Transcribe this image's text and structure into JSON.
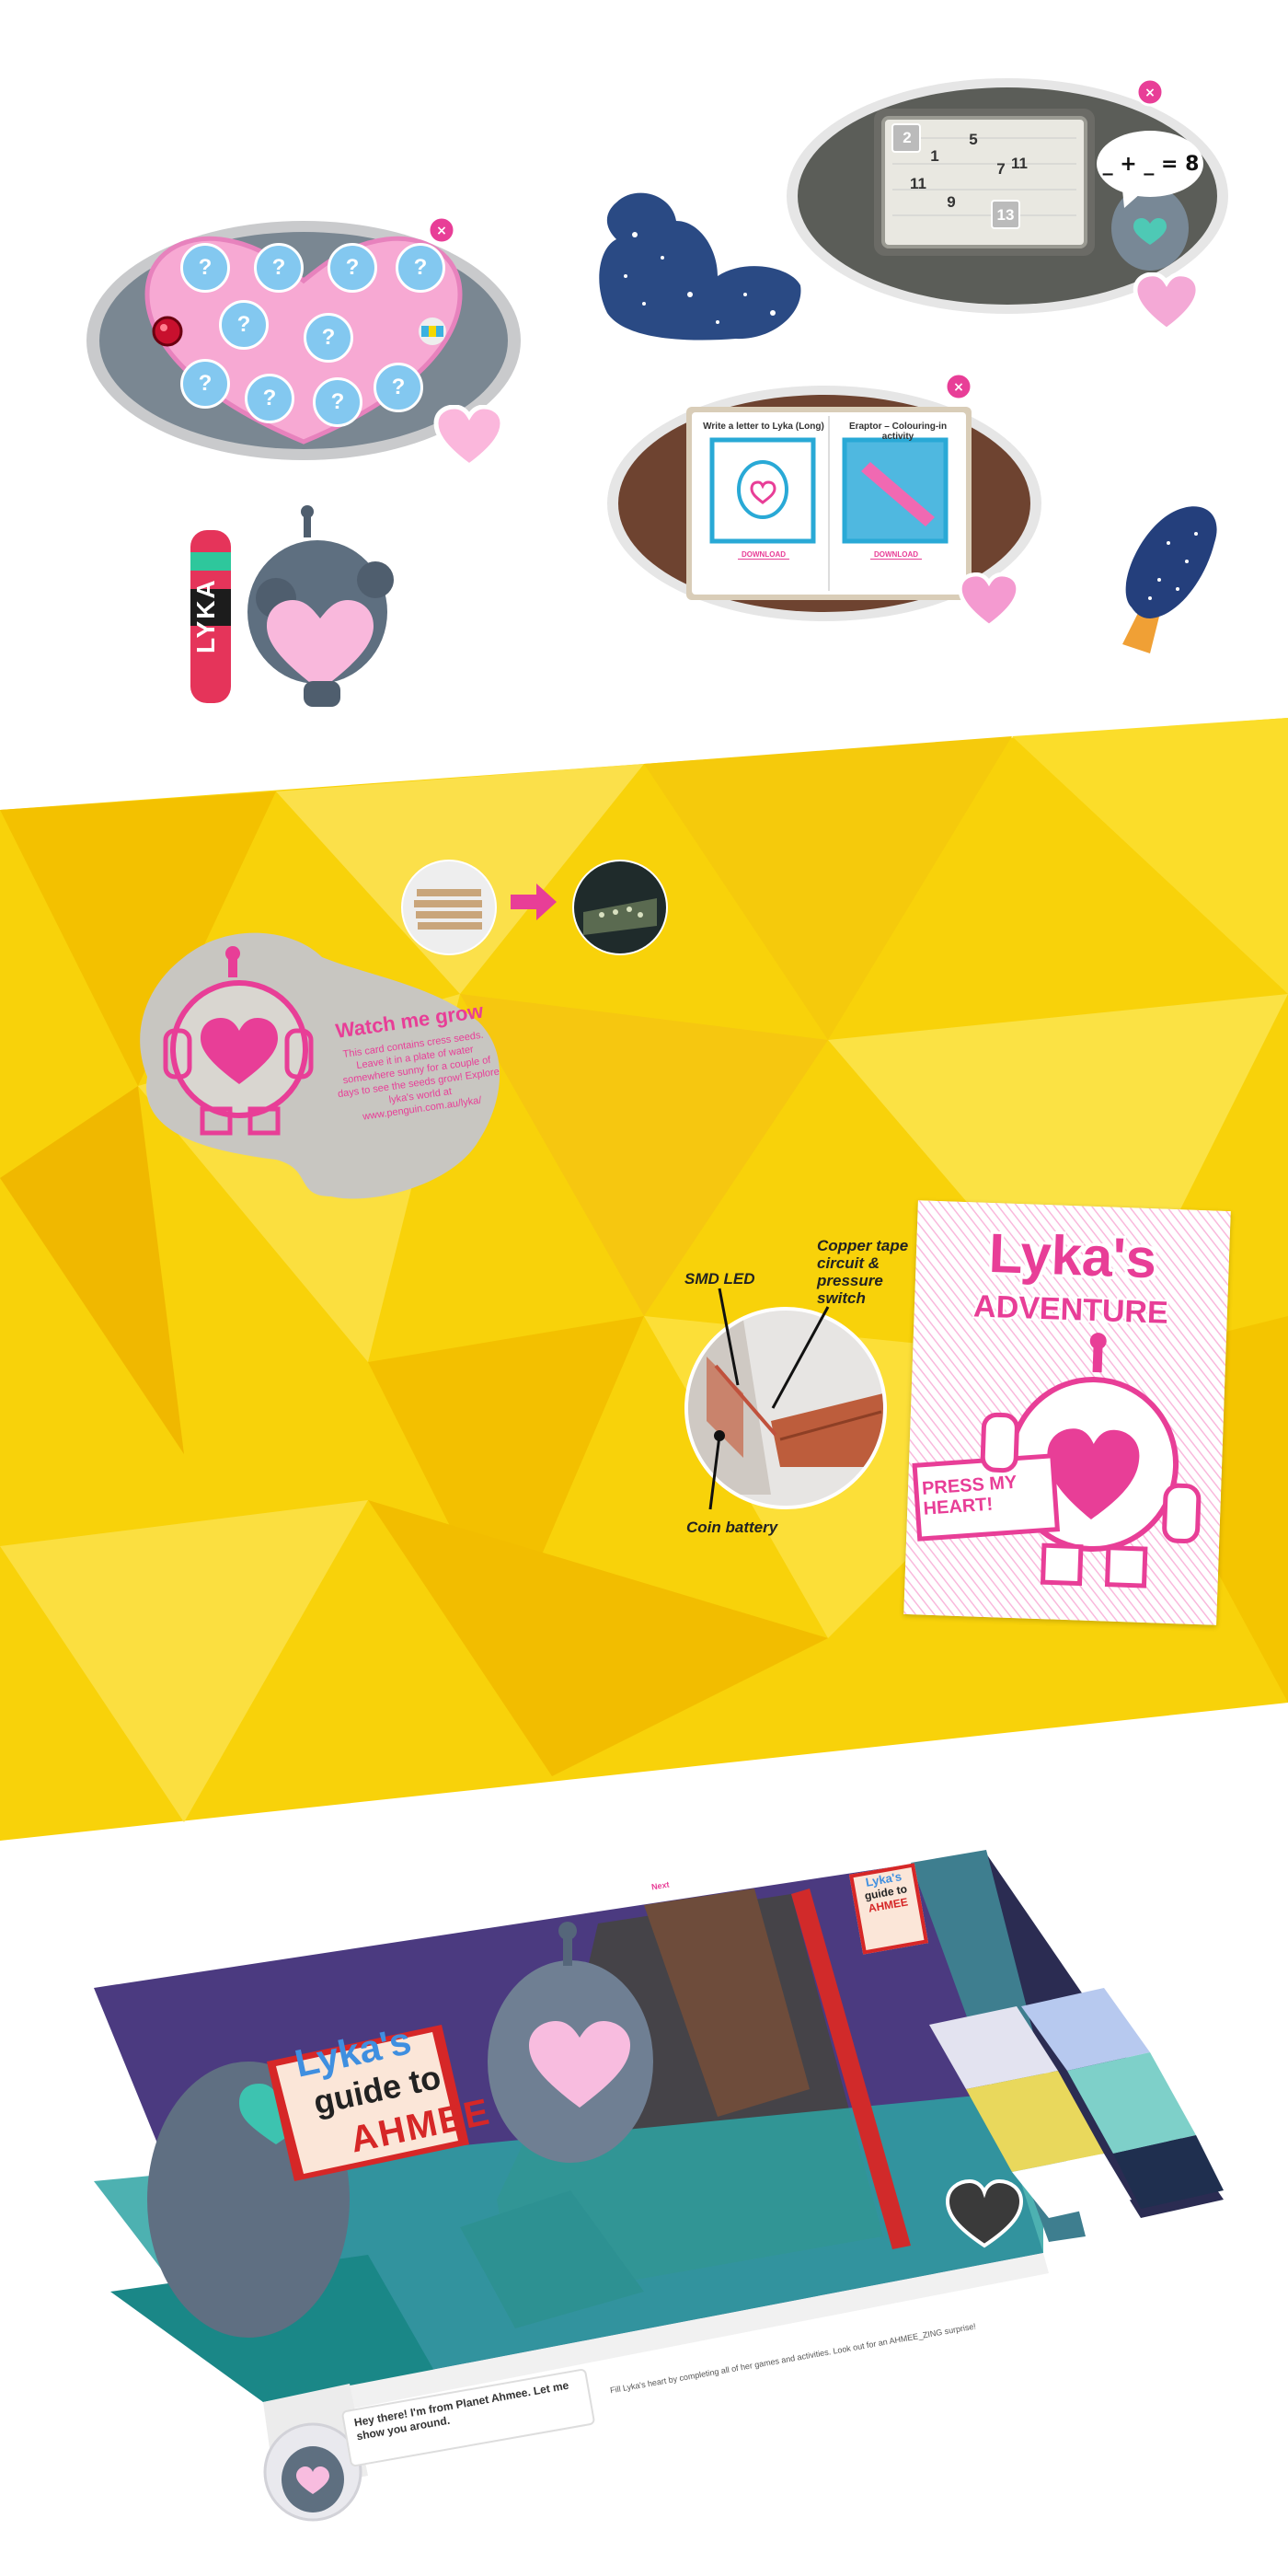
{
  "puzzle_card": {
    "symbols": [
      "?",
      "?",
      "?",
      "?",
      "?",
      "?",
      "?",
      "?",
      "?",
      "?",
      "?",
      "?"
    ]
  },
  "math_game": {
    "numbers": [
      "2",
      "5",
      "1",
      "7",
      "11",
      "11",
      "9",
      "13"
    ],
    "equation": "_ + _ = 8"
  },
  "activities": {
    "left_title": "Write a letter to Lyka (Long)",
    "right_title": "Eraptor – Colouring-in activity",
    "left_button": "DOWNLOAD",
    "right_button": "DOWNLOAD"
  },
  "bookmark": {
    "text": "LYKA"
  },
  "seed_card": {
    "title": "Watch me grow",
    "body": "This card contains cress seeds. Leave it in a plate of water somewhere sunny for a couple of days to see the seeds grow! Explore lyka's world at www.penguin.com.au/lyka/"
  },
  "circuit": {
    "label_led": "SMD LED",
    "label_copper": "Copper tape circuit & pressure switch",
    "label_battery": "Coin battery"
  },
  "book_cover": {
    "title_line1": "Lyka's",
    "title_line2": "ADVENTURE",
    "press": "PRESS MY HEART!"
  },
  "website": {
    "sign_line1": "Lyka's",
    "sign_line2": "guide to",
    "sign_line3": "AHMEE",
    "speech": "Hey there! I'm from Planet Ahmee. Let me show you around.",
    "footer_text": "Fill Lyka's heart by completing all of her games and activities. Look out for an AHMEE_ZING surprise!",
    "top_nav": "Next",
    "side_sign_line1": "Lyka's",
    "side_sign_line2": "guide to",
    "side_sign_line3": "AHMEE"
  },
  "colors": {
    "pink": "#e83e97",
    "light_pink": "#fbb7dc",
    "yellow": "#f8d20a",
    "robot_grey": "#5e6f80",
    "navy": "#283c73"
  }
}
